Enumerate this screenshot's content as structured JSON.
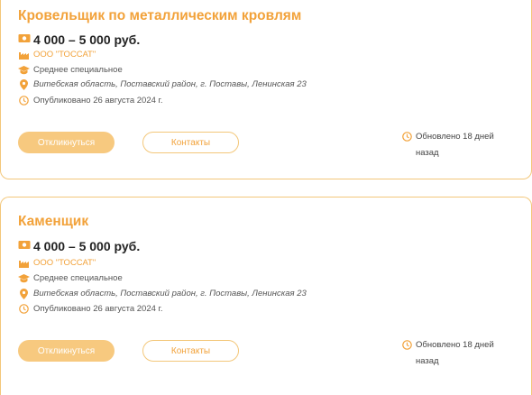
{
  "vacancies": [
    {
      "title": "Кровельщик по металлическим кровлям",
      "salary": "4 000 – 5 000 руб.",
      "company": "ООО \"ТОССАТ\"",
      "education": "Среднее специальное",
      "address": "Витебская область, Поставский район, г. Поставы, Ленинская 23",
      "published": "Опубликовано 26 августа 2024 г.",
      "apply_label": "Откликнуться",
      "contacts_label": "Контакты",
      "updated": "Обновлено 18 дней назад"
    },
    {
      "title": "Каменщик",
      "salary": "4 000 – 5 000 руб.",
      "company": "ООО \"ТОССАТ\"",
      "education": "Среднее специальное",
      "address": "Витебская область, Поставский район, г. Поставы, Ленинская 23",
      "published": "Опубликовано 26 августа 2024 г.",
      "apply_label": "Откликнуться",
      "contacts_label": "Контакты",
      "updated": "Обновлено 18 дней назад"
    }
  ],
  "colors": {
    "accent": "#f2a23a",
    "button_fill": "#f7c97f",
    "border": "#f3c77a"
  }
}
